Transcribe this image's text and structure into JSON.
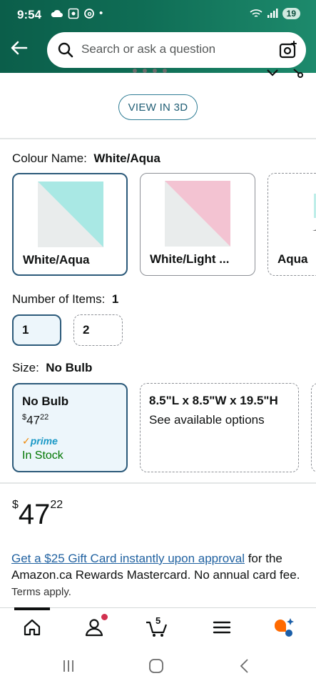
{
  "status": {
    "time": "9:54",
    "dot": "•",
    "battery": "19"
  },
  "search": {
    "placeholder": "Search or ask a question"
  },
  "view3d": {
    "label": "VIEW IN 3D"
  },
  "colour": {
    "label": "Colour Name:",
    "selected": "White/Aqua",
    "options": [
      {
        "name": "White/Aqua",
        "accent": "#a9e8e4"
      },
      {
        "name": "White/Light ...",
        "accent": "#f3c3d2"
      },
      {
        "name": "Aqua",
        "accent": "#a9e8e4"
      }
    ]
  },
  "items": {
    "label": "Number of Items:",
    "selected": "1",
    "options": [
      "1",
      "2"
    ]
  },
  "size": {
    "label": "Size:",
    "selected": "No Bulb",
    "options": [
      {
        "title": "No Bulb",
        "price_currency": "$",
        "price_whole": "47",
        "price_cents": "22",
        "prime": "prime",
        "availability": "In Stock"
      },
      {
        "title": "8.5\"L x 8.5\"W x 19.5\"H",
        "subtitle": "See available options"
      }
    ]
  },
  "price": {
    "currency": "$",
    "whole": "47",
    "cents": "22"
  },
  "promo": {
    "link": "Get a $25 Gift Card instantly upon approval",
    "text": " for the Amazon.ca Rewards Mastercard. No annual card fee.",
    "terms": "Terms apply."
  },
  "nav": {
    "cart_count": "5"
  },
  "colors": {
    "header": "#0f6d55",
    "selected_border": "#2c5a7a",
    "link": "#2162a1",
    "stock": "#007600",
    "prime": "#1a98c6"
  },
  "icons": [
    "back-arrow-icon",
    "search-icon",
    "camera-icon",
    "home-icon",
    "account-icon",
    "cart-icon",
    "menu-icon",
    "rufus-icon"
  ]
}
